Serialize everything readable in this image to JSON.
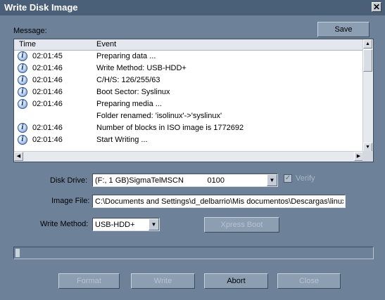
{
  "window": {
    "title": "Write Disk Image",
    "close_glyph": "✕"
  },
  "message_label": "Message:",
  "save_button": "Save",
  "log": {
    "columns": [
      "Time",
      "Event"
    ],
    "rows": [
      {
        "icon": "info-icon",
        "time": "02:01:45",
        "event": "Preparing data ..."
      },
      {
        "icon": "info-icon",
        "time": "02:01:46",
        "event": "Write Method: USB-HDD+"
      },
      {
        "icon": "info-icon",
        "time": "02:01:46",
        "event": "C/H/S: 126/255/63"
      },
      {
        "icon": "info-icon",
        "time": "02:01:46",
        "event": "Boot Sector: Syslinux"
      },
      {
        "icon": "info-icon",
        "time": "02:01:46",
        "event": "Preparing media ..."
      },
      {
        "icon": "",
        "time": "",
        "event": "Folder renamed: 'isolinux'->'syslinux'"
      },
      {
        "icon": "info-icon",
        "time": "02:01:46",
        "event": "Number of blocks in ISO image is 1772692"
      },
      {
        "icon": "info-icon",
        "time": "02:01:46",
        "event": "Start Writing ..."
      }
    ]
  },
  "disk_drive": {
    "label": "Disk Drive:",
    "value": "(F:, 1 GB)SigmaTelMSCN           0100"
  },
  "verify": {
    "label": "Verify",
    "checked": true
  },
  "image_file": {
    "label": "Image File:",
    "value": "C:\\Documents and Settings\\d_delbarrio\\Mis documentos\\Descargas\\linux"
  },
  "write_method": {
    "label": "Write Method:",
    "value": "USB-HDD+"
  },
  "xpress_boot": "Xpress Boot",
  "progress": {
    "fraction": 0.01
  },
  "buttons": {
    "format": "Format",
    "write": "Write",
    "abort": "Abort",
    "close": "Close"
  }
}
